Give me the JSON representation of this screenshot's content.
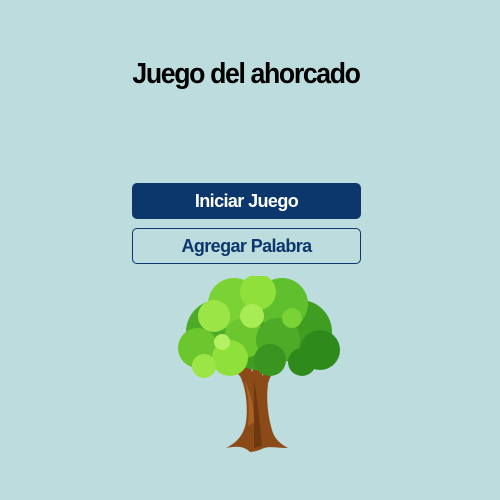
{
  "app": {
    "title": "Juego del ahorcado"
  },
  "menu": {
    "start_label": "Iniciar Juego",
    "add_word_label": "Agregar Palabra"
  },
  "illustration": {
    "icon": "tree-icon"
  },
  "colors": {
    "background": "#bcdcdd",
    "primary": "#0b376d",
    "title_text": "#000000",
    "foliage_light": "#8fe03a",
    "foliage_dark": "#3f9d22",
    "trunk": "#8b4a17"
  }
}
